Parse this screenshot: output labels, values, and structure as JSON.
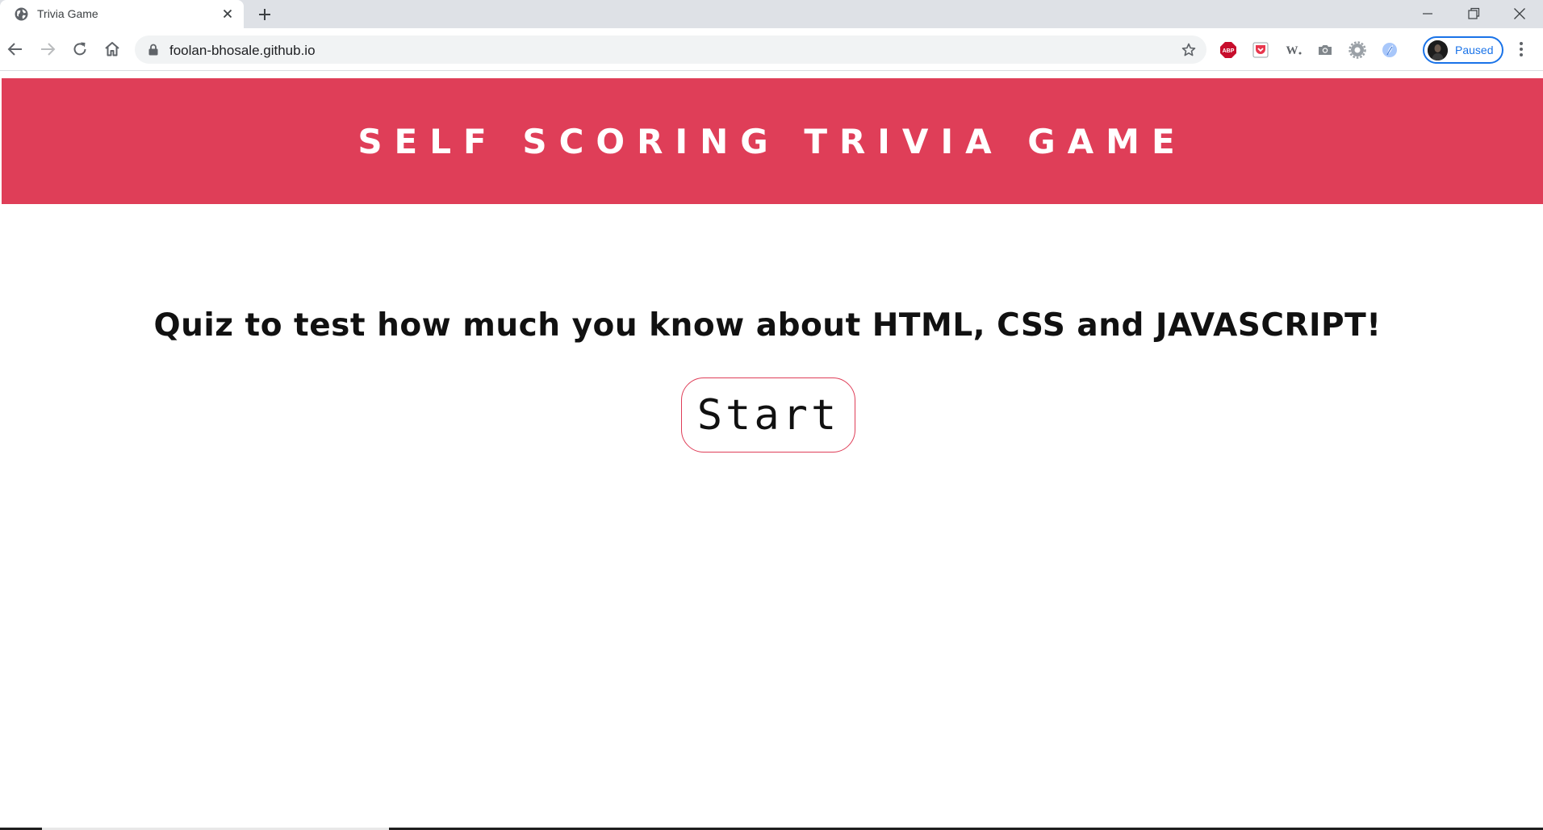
{
  "browser": {
    "tab": {
      "title": "Trivia Game"
    },
    "address_bar": {
      "url": "foolan-bhosale.github.io"
    },
    "profile": {
      "status_label": "Paused"
    },
    "colors": {
      "tabstrip": "#dee1e6",
      "omnibox": "#f1f3f4",
      "profile_accent": "#1a73e8"
    },
    "extensions": [
      "adblock-plus-icon",
      "pocket-icon",
      "w-extension-icon",
      "camera-icon",
      "gear-extension-icon",
      "blue-leaf-icon"
    ]
  },
  "page": {
    "header": {
      "title": "Self Scoring Trivia Game"
    },
    "intro": {
      "text": "Quiz to test how much you know about HTML, CSS and JAVASCRIPT!"
    },
    "start_button": {
      "label": "Start"
    },
    "colors": {
      "accent": "#df3e58",
      "text": "#111111",
      "background": "#ffffff"
    }
  }
}
